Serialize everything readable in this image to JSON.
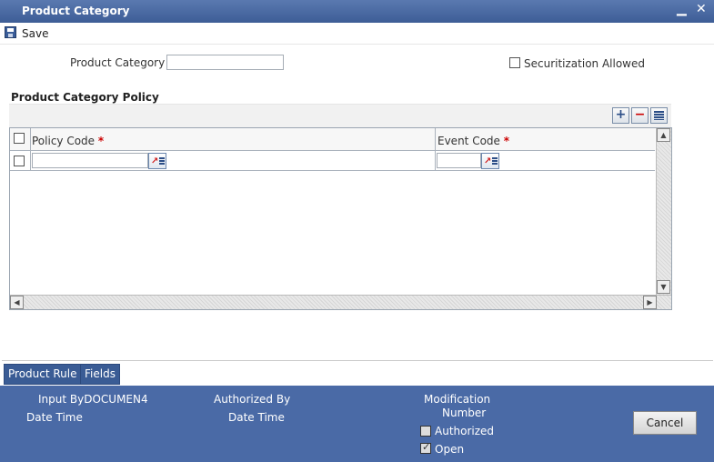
{
  "window": {
    "title": "Product Category",
    "minimize_label": "▁",
    "close_label": "✕"
  },
  "toolbar": {
    "save_label": "Save"
  },
  "form": {
    "product_category_label": "Product Category",
    "product_category_value": "",
    "required_mark": "*",
    "securitization_label": "Securitization Allowed",
    "securitization_checked": false
  },
  "policy_section": {
    "title": "Product Category Policy",
    "add_label": "+",
    "remove_label": "−",
    "columns": [
      "Policy Code",
      "Event Code"
    ],
    "rows": [
      {
        "policy_code": "",
        "event_code": ""
      }
    ]
  },
  "tabs": [
    {
      "label": "Product Rule"
    },
    {
      "label": "Fields"
    }
  ],
  "footer": {
    "input_by_label": "Input By",
    "input_by_value": "DOCUMEN4",
    "date_time_label": "Date Time",
    "authorized_by_label": "Authorized By",
    "auth_date_time_label": "Date Time",
    "modification_label": "Modification",
    "number_label": "Number",
    "authorized_label": "Authorized",
    "authorized_checked": false,
    "open_label": "Open",
    "open_checked": true,
    "cancel_label": "Cancel"
  },
  "colors": {
    "titlebar": "#3d5d96",
    "footer": "#4a6aa6",
    "tab_button": "#3a5c95",
    "required": "#cc0000"
  }
}
